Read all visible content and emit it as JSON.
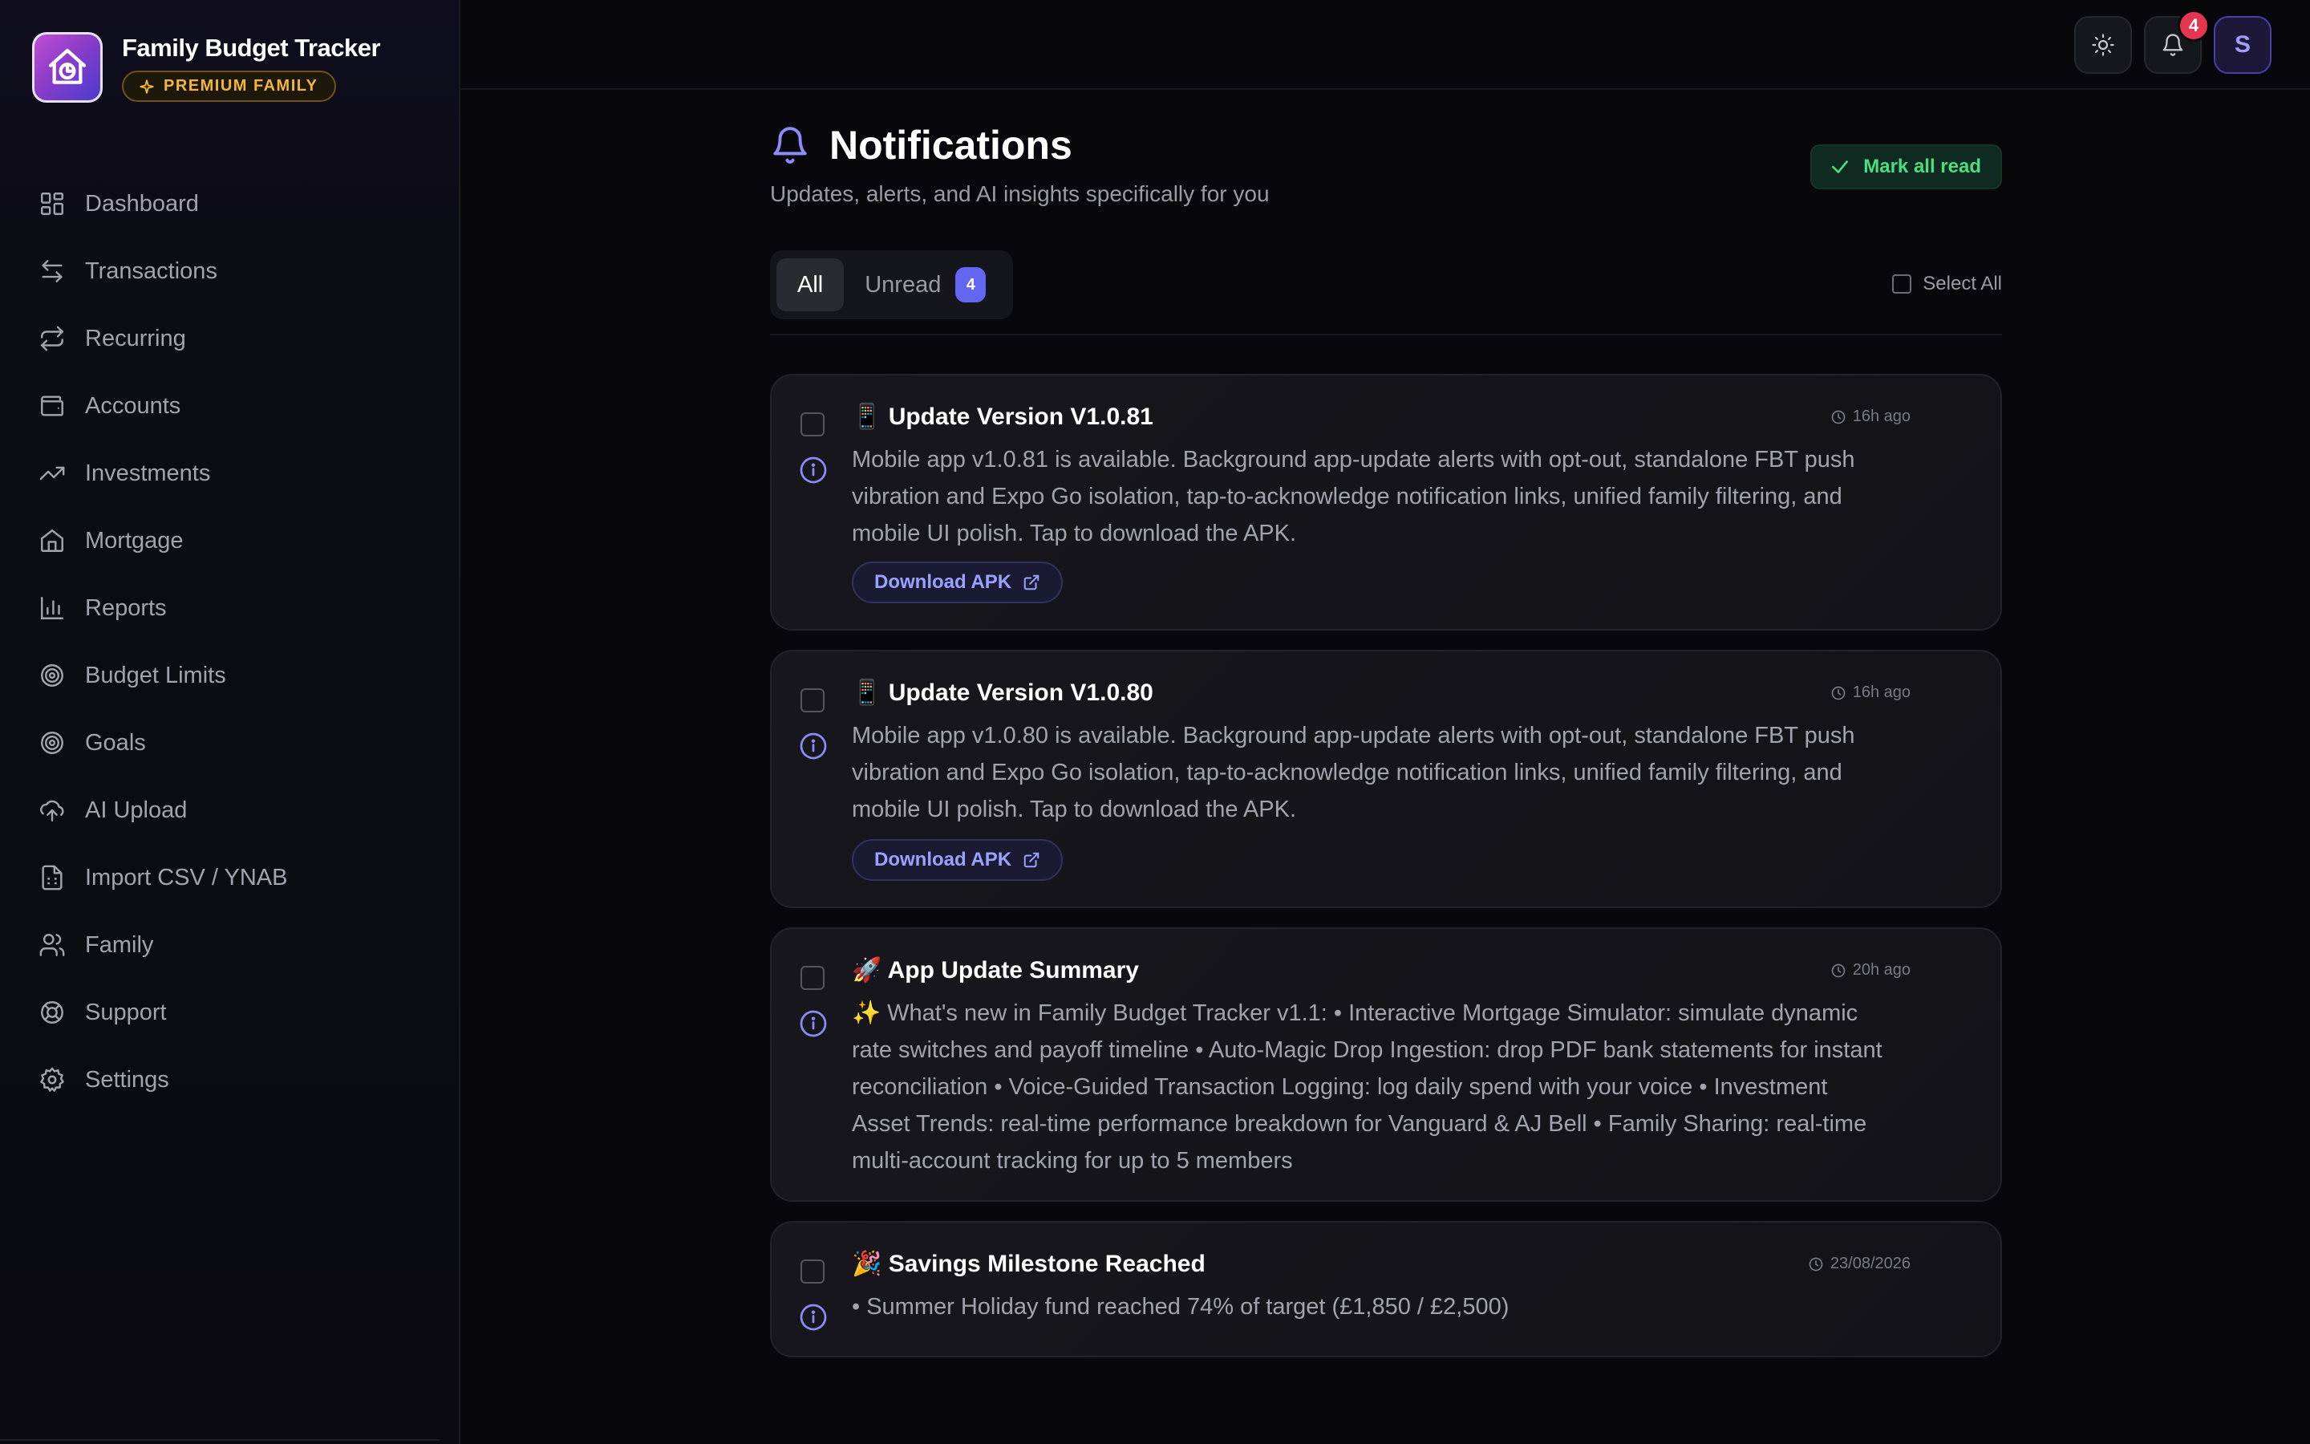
{
  "app": {
    "title": "Family Budget Tracker",
    "badge": "PREMIUM FAMILY"
  },
  "sidebar": {
    "items": [
      {
        "label": "Dashboard",
        "icon": "grid-icon"
      },
      {
        "label": "Transactions",
        "icon": "arrows-left-right-icon"
      },
      {
        "label": "Recurring",
        "icon": "repeat-icon"
      },
      {
        "label": "Accounts",
        "icon": "wallet-icon"
      },
      {
        "label": "Investments",
        "icon": "trending-up-icon"
      },
      {
        "label": "Mortgage",
        "icon": "house-icon"
      },
      {
        "label": "Reports",
        "icon": "bar-chart-icon"
      },
      {
        "label": "Budget Limits",
        "icon": "target-icon"
      },
      {
        "label": "Goals",
        "icon": "goal-target-icon"
      },
      {
        "label": "AI Upload",
        "icon": "cloud-upload-icon"
      },
      {
        "label": "Import CSV / YNAB",
        "icon": "file-spreadsheet-icon"
      },
      {
        "label": "Family",
        "icon": "users-icon"
      },
      {
        "label": "Support",
        "icon": "lifebuoy-icon"
      },
      {
        "label": "Settings",
        "icon": "gear-icon"
      }
    ]
  },
  "topbar": {
    "notification_count": "4",
    "avatar_initial": "S"
  },
  "page": {
    "title": "Notifications",
    "subtitle": "Updates, alerts, and AI insights specifically for you",
    "mark_all_label": "Mark all read"
  },
  "filters": {
    "tab_all": "All",
    "tab_unread": "Unread",
    "unread_count": "4",
    "select_all": "Select All"
  },
  "notifications": [
    {
      "title": "📱 Update Version V1.0.81",
      "time": "16h ago",
      "body": "Mobile app v1.0.81 is available. Background app-update alerts with opt-out, standalone FBT push vibration and Expo Go isolation, tap-to-acknowledge notification links, unified family filtering, and mobile UI polish. Tap to download the APK.",
      "action": "Download APK"
    },
    {
      "title": "📱 Update Version V1.0.80",
      "time": "16h ago",
      "body": "Mobile app v1.0.80 is available. Background app-update alerts with opt-out, standalone FBT push vibration and Expo Go isolation, tap-to-acknowledge notification links, unified family filtering, and mobile UI polish. Tap to download the APK.",
      "action": "Download APK"
    },
    {
      "title": "🚀 App Update Summary",
      "time": "20h ago",
      "body": "✨ What's new in Family Budget Tracker v1.1: • Interactive Mortgage Simulator: simulate dynamic rate switches and payoff timeline • Auto-Magic Drop Ingestion: drop PDF bank statements for instant reconciliation • Voice-Guided Transaction Logging: log daily spend with your voice • Investment Asset Trends: real-time performance breakdown for Vanguard & AJ Bell • Family Sharing: real-time multi-account tracking for up to 5 members"
    },
    {
      "title": "🎉 Savings Milestone Reached",
      "time": "23/08/2026",
      "body": "• Summer Holiday fund reached 74% of target (£1,850 / £2,500)"
    }
  ],
  "colors": {
    "accent": "#6366f1",
    "success": "#4ade80",
    "premium": "#f0b73a",
    "badge_red": "#e5354f"
  }
}
